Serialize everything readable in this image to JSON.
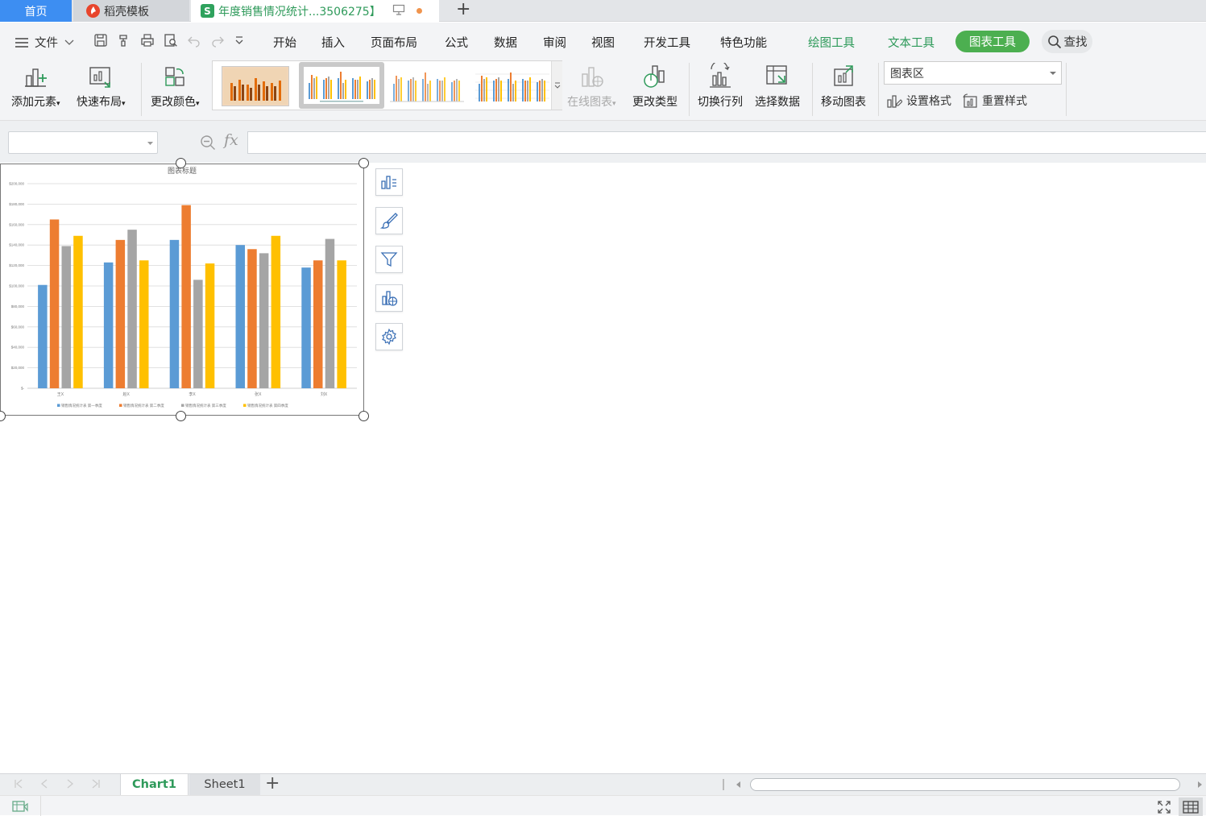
{
  "tabs": {
    "home": "首页",
    "daoke": "稻壳模板",
    "doc": "年度销售情况统计...3506275】",
    "doc_badge": "S",
    "new_tab": "+"
  },
  "menu": {
    "file": "文件",
    "items": [
      "开始",
      "插入",
      "页面布局",
      "公式",
      "数据",
      "审阅",
      "视图",
      "开发工具",
      "特色功能"
    ],
    "draw_tools": "绘图工具",
    "text_tools": "文本工具",
    "chart_tools": "图表工具",
    "search": "查找"
  },
  "ribbon": {
    "add_element": "添加元素",
    "quick_layout": "快速布局",
    "change_color": "更改颜色",
    "online_chart": "在线图表",
    "change_type": "更改类型",
    "switch_rowcol": "切换行列",
    "select_data": "选择数据",
    "move_chart": "移动图表",
    "chart_area_select": "图表区",
    "set_format": "设置格式",
    "reset_style": "重置样式"
  },
  "formula": {
    "fx": "fx",
    "name_box": "",
    "content": ""
  },
  "chart_data": {
    "type": "bar",
    "title": "图表标题",
    "categories": [
      "王X",
      "赵X",
      "李X",
      "张X",
      "刘X"
    ],
    "ylim": [
      0,
      200000
    ],
    "yticks": [
      "$-",
      "$20,000",
      "$40,000",
      "$60,000",
      "$80,000",
      "$100,000",
      "$120,000",
      "$140,000",
      "$160,000",
      "$180,000",
      "$200,000"
    ],
    "grid": true,
    "legend_position": "bottom",
    "series": [
      {
        "name": "销售情况统计表 第一季度",
        "color": "#5b9bd5",
        "values": [
          101000,
          123000,
          145000,
          140000,
          118000
        ]
      },
      {
        "name": "销售情况统计表 第二季度",
        "color": "#ed7d31",
        "values": [
          165000,
          145000,
          179000,
          136000,
          125000
        ]
      },
      {
        "name": "销售情况统计表 第三季度",
        "color": "#a5a5a5",
        "values": [
          139000,
          155000,
          106000,
          132000,
          146000
        ]
      },
      {
        "name": "销售情况统计表 第四季度",
        "color": "#ffc000",
        "values": [
          149000,
          125000,
          122000,
          149000,
          125000
        ]
      }
    ]
  },
  "sheets": {
    "active": "Chart1",
    "other": "Sheet1",
    "add": "+"
  },
  "colors": {
    "accent_green": "#4caf50",
    "tab_blue": "#3d8ef2"
  }
}
